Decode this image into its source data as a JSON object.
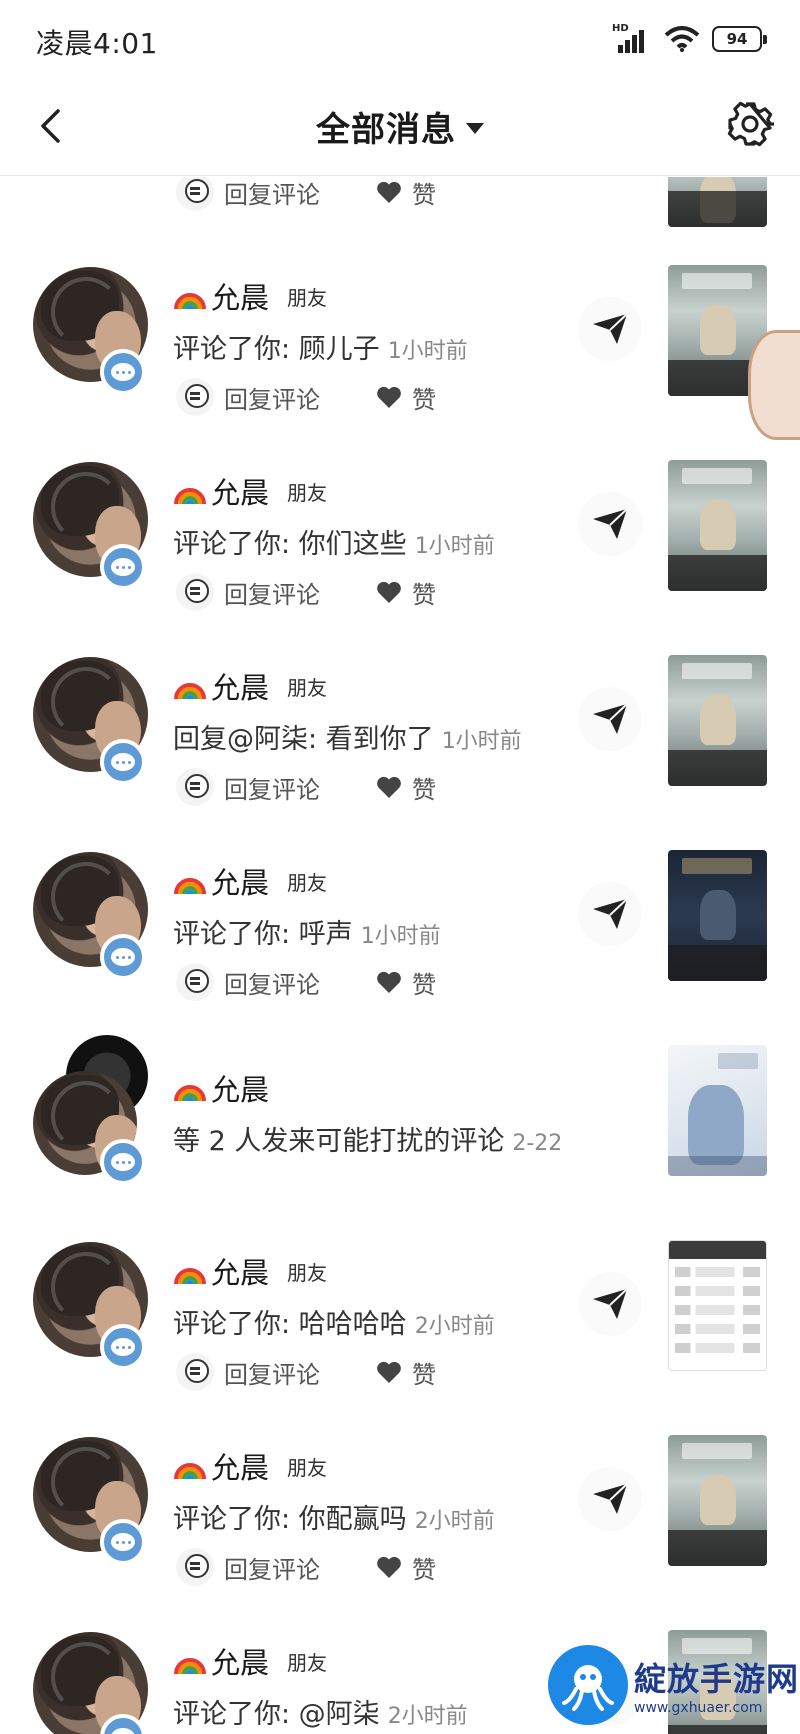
{
  "status_bar": {
    "time": "凌晨4:01",
    "network": "HD",
    "battery": "94"
  },
  "header": {
    "title": "全部消息"
  },
  "actions": {
    "reply_label": "回复评论",
    "like_label": "赞"
  },
  "items": [
    {
      "name": "",
      "tag": "",
      "text": "",
      "time": "",
      "thumb": "game"
    },
    {
      "name": "允晨",
      "tag": "朋友",
      "text": "评论了你: 顾儿子",
      "time": "1小时前",
      "thumb": "game"
    },
    {
      "name": "允晨",
      "tag": "朋友",
      "text": "评论了你: 你们这些",
      "time": "1小时前",
      "thumb": "game"
    },
    {
      "name": "允晨",
      "tag": "朋友",
      "text": "回复@阿柒:  看到你了",
      "time": "1小时前",
      "thumb": "game"
    },
    {
      "name": "允晨",
      "tag": "朋友",
      "text": "评论了你: 呼声",
      "time": "1小时前",
      "thumb": "dark"
    },
    {
      "name": "允晨",
      "tag": "",
      "text": "等 2 人发来可能打扰的评论",
      "time": "2-22",
      "thumb": "light"
    },
    {
      "name": "允晨",
      "tag": "朋友",
      "text": "评论了你: 哈哈哈哈",
      "time": "2小时前",
      "thumb": "table"
    },
    {
      "name": "允晨",
      "tag": "朋友",
      "text": "评论了你: 你配赢吗",
      "time": "2小时前",
      "thumb": "game"
    },
    {
      "name": "允晨",
      "tag": "朋友",
      "text": "评论了你: @阿柒",
      "time": "2小时前",
      "thumb": "game"
    }
  ],
  "watermark": {
    "name": "綻放手游网",
    "url": "www.gxhuaer.com"
  },
  "colors": {
    "badge": "#5e9bd6",
    "watermark": "#1e3a8a"
  }
}
